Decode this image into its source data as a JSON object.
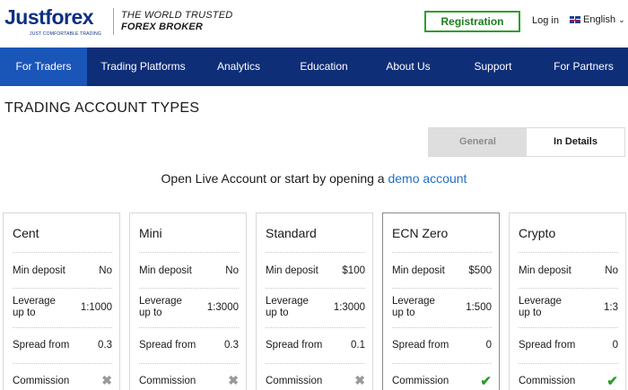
{
  "header": {
    "logo_text": "Justforex",
    "logo_sub": "JUST COMFORTABLE TRADING",
    "tagline_1": "THE WORLD TRUSTED",
    "tagline_2": "FOREX BROKER",
    "register_label": "Registration",
    "login_label": "Log in",
    "language": "English"
  },
  "nav": {
    "items": [
      {
        "label": "For Traders",
        "active": true
      },
      {
        "label": "Trading Platforms"
      },
      {
        "label": "Analytics"
      },
      {
        "label": "Education"
      },
      {
        "label": "About Us"
      },
      {
        "label": "Support"
      },
      {
        "label": "For Partners"
      }
    ]
  },
  "main": {
    "title": "TRADING ACCOUNT TYPES",
    "toggle": {
      "general": "General",
      "details": "In Details",
      "selected": "In Details"
    },
    "open_text": "Open Live Account or start by opening a",
    "open_link": "demo account"
  },
  "row_labels": {
    "min_deposit": "Min deposit",
    "leverage_1": "Leverage",
    "leverage_2": "up to",
    "spread": "Spread from",
    "commission": "Commission"
  },
  "accounts": [
    {
      "name": "Cent",
      "min_deposit": "No",
      "leverage": "1:1000",
      "spread": "0.3",
      "commission": "no",
      "commission_icon": "cross-icon"
    },
    {
      "name": "Mini",
      "min_deposit": "No",
      "leverage": "1:3000",
      "spread": "0.3",
      "commission": "no",
      "commission_icon": "cross-icon"
    },
    {
      "name": "Standard",
      "min_deposit": "$100",
      "leverage": "1:3000",
      "spread": "0.1",
      "commission": "no",
      "commission_icon": "cross-icon"
    },
    {
      "name": "ECN Zero",
      "min_deposit": "$500",
      "leverage": "1:500",
      "spread": "0",
      "commission": "yes",
      "commission_icon": "check-icon"
    },
    {
      "name": "Crypto",
      "min_deposit": "No",
      "leverage": "1:3",
      "spread": "0",
      "commission": "yes",
      "commission_icon": "check-icon"
    }
  ],
  "colors": {
    "nav_bg": "#0e2e78",
    "nav_active": "#1a56b8",
    "brand": "#0d2f82",
    "register_green": "#2f9e2f",
    "link_blue": "#1f6fc5",
    "check_green": "#2d9c2d",
    "cross_gray": "#9a9a9a"
  }
}
